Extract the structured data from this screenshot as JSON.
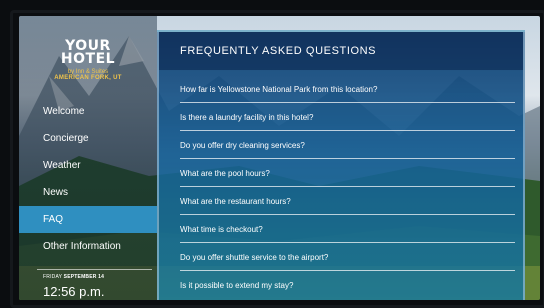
{
  "hotel": {
    "logo_line1": "YOUR",
    "logo_line2": "HOTEL",
    "logo_sub1": "by Inn & Suites",
    "logo_sub2": "AMERICAN FORK, UT"
  },
  "sidebar": {
    "items": [
      {
        "label": "Welcome"
      },
      {
        "label": "Concierge"
      },
      {
        "label": "Weather"
      },
      {
        "label": "News"
      },
      {
        "label": "FAQ"
      },
      {
        "label": "Other Information"
      }
    ],
    "active_index": 4
  },
  "clock": {
    "day": "FRIDAY",
    "date": "SEPTEMBER 14",
    "time": "12:56 p.m."
  },
  "main": {
    "title": "FREQUENTLY ASKED QUESTIONS",
    "questions": [
      "How far is Yellowstone National Park from this location?",
      "Is there a laundry facility in this hotel?",
      "Do you offer dry cleaning services?",
      "What are the pool hours?",
      "What are the restaurant hours?",
      "What time is checkout?",
      "Do you offer shuttle service to the airport?",
      "Is it possible to extend my stay?"
    ]
  },
  "colors": {
    "accent": "#2f8fc0",
    "logo_gold": "#f0c44a",
    "panel_blue": "#145f96"
  }
}
